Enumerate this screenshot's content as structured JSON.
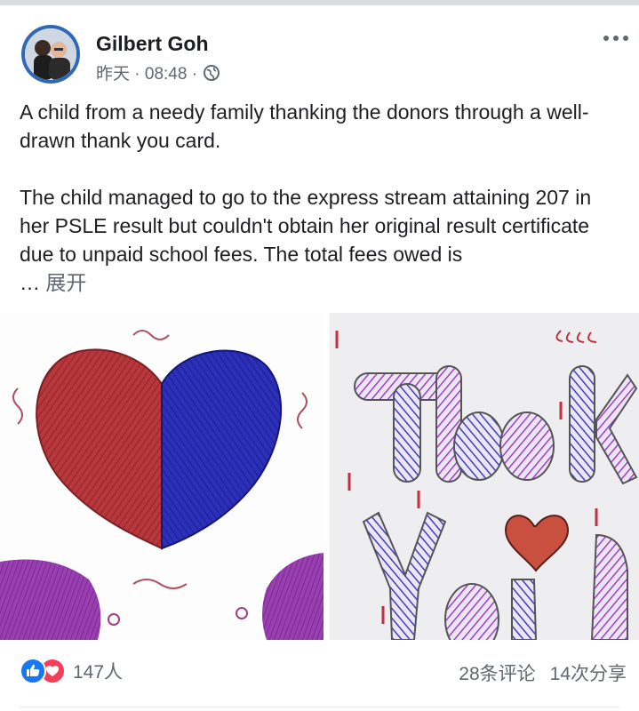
{
  "post": {
    "author": "Gilbert Goh",
    "timestamp": "昨天 · 08:48 ·",
    "paragraph1": "A child from a needy family thanking the donors through a well-drawn thank you card.",
    "paragraph2": "The child managed to go to the express stream attaining 207 in her PSLE result but couldn't obtain her original result certificate due to unpaid school fees. The total fees owed is",
    "ellipsis": "…",
    "see_more": "展开"
  },
  "photos": {
    "left_icon": "heart-drawing",
    "right_icon": "thank-you-drawing"
  },
  "footer": {
    "reaction_count": "147人",
    "comments": "28条评论",
    "shares": "14次分享"
  },
  "colors": {
    "like": "#1877f2",
    "love": "#f33e58",
    "secondary_text": "#606770"
  }
}
